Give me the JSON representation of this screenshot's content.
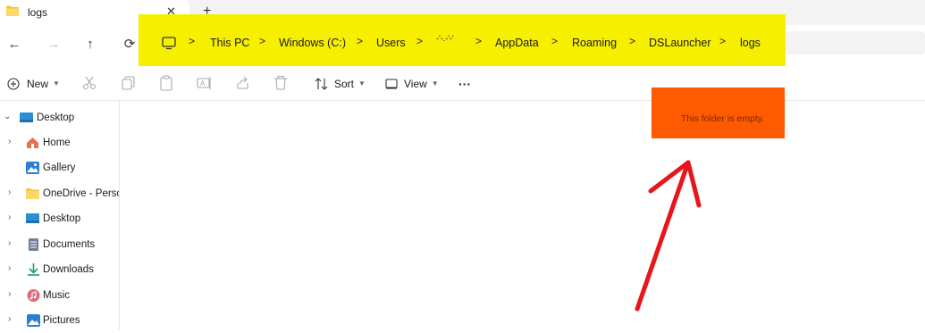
{
  "tab": {
    "title": "logs",
    "close": "✕",
    "new_tab": "+"
  },
  "nav": {
    "back": "←",
    "forward": "→",
    "up": "↑",
    "refresh": "⟳"
  },
  "breadcrumb": {
    "separator": ">",
    "items": [
      "This PC",
      "Windows (C:)",
      "Users",
      "-'-.-'-'",
      "AppData",
      "Roaming",
      "DSLauncher",
      "logs"
    ]
  },
  "toolbar": {
    "new_label": "New",
    "sort_label": "Sort",
    "view_label": "View",
    "more_label": "···"
  },
  "sidebar": {
    "items": [
      {
        "label": "Desktop",
        "icon": "desktop-icon"
      },
      {
        "label": "Home",
        "icon": "home-icon"
      },
      {
        "label": "Gallery",
        "icon": "gallery-icon"
      },
      {
        "label": "OneDrive - Persor",
        "icon": "folder-icon"
      },
      {
        "label": "Desktop",
        "icon": "desktop-icon"
      },
      {
        "label": "Documents",
        "icon": "documents-icon"
      },
      {
        "label": "Downloads",
        "icon": "downloads-icon"
      },
      {
        "label": "Music",
        "icon": "music-icon"
      },
      {
        "label": "Pictures",
        "icon": "pictures-icon"
      }
    ]
  },
  "content": {
    "empty_message": "This folder is empty."
  },
  "colors": {
    "highlight_yellow": "#f7ef00",
    "highlight_orange": "#ff5a00",
    "arrow_red": "#e8151b"
  }
}
